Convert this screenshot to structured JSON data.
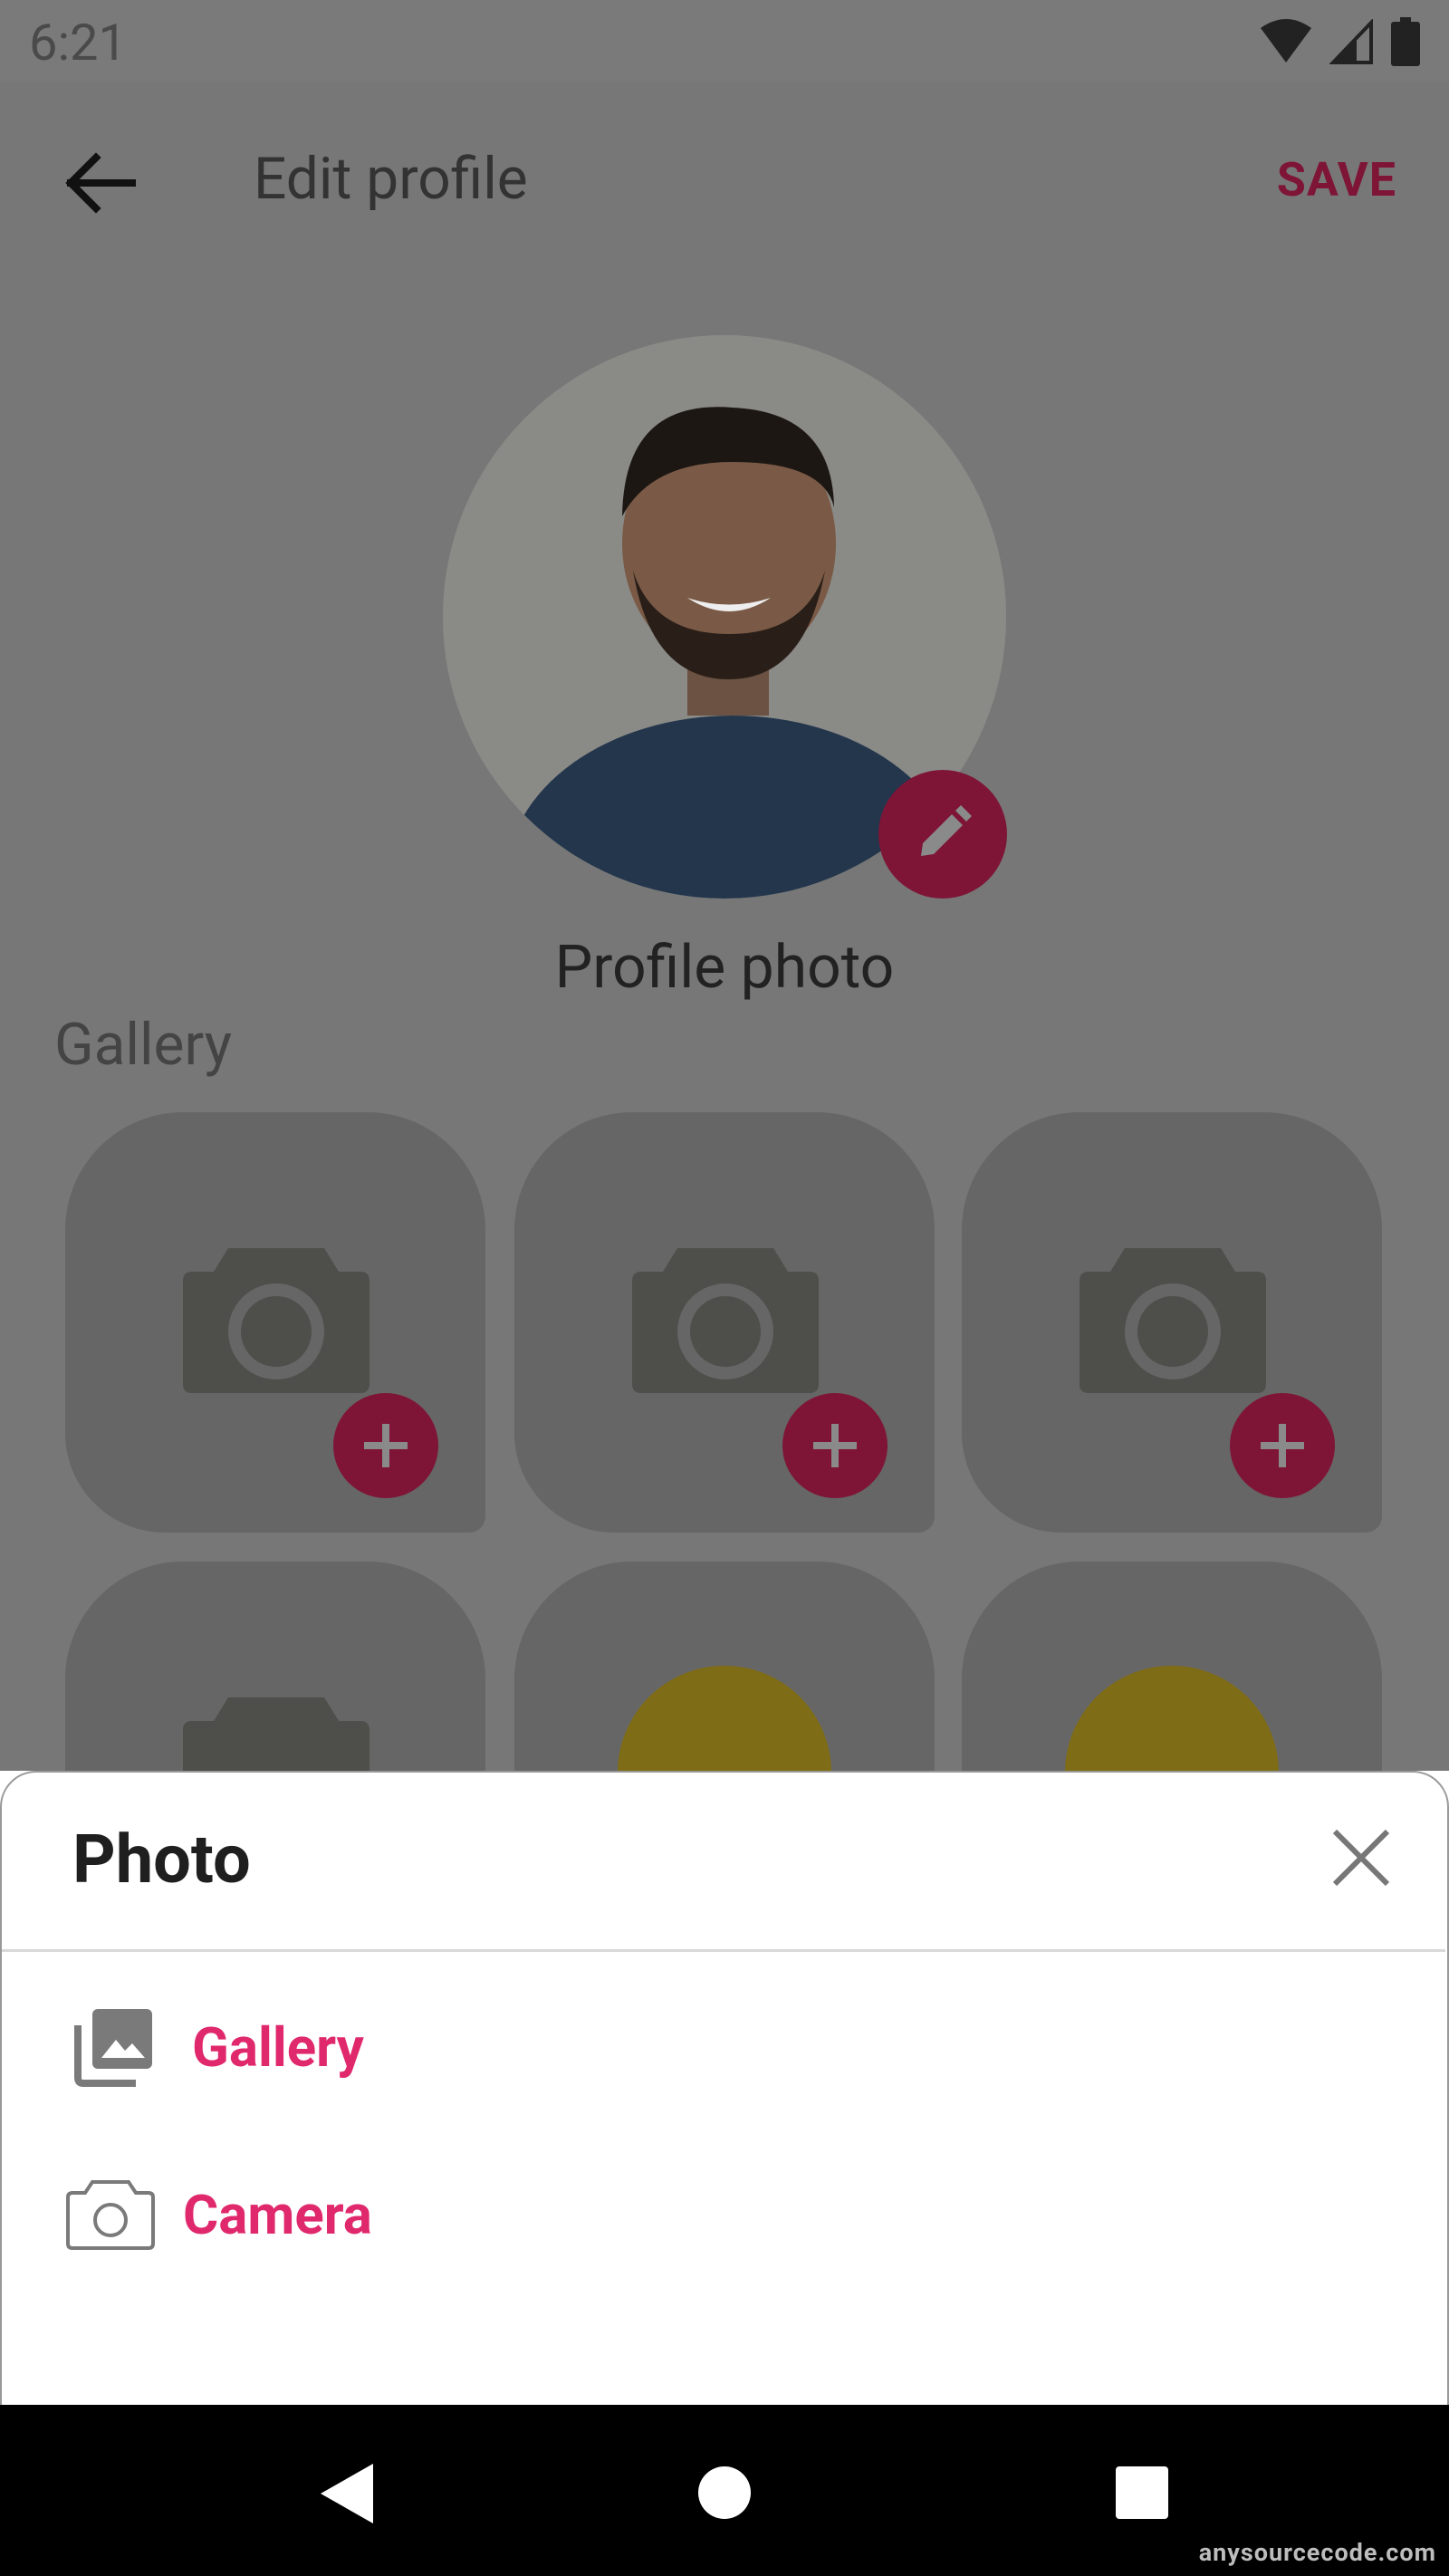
{
  "status_bar": {
    "time": "6:21"
  },
  "app_bar": {
    "title": "Edit profile",
    "save_label": "SAVE"
  },
  "profile": {
    "label": "Profile photo"
  },
  "gallery": {
    "label": "Gallery"
  },
  "sheet": {
    "title": "Photo",
    "options": [
      {
        "label": "Gallery",
        "icon": "photo-library-icon"
      },
      {
        "label": "Camera",
        "icon": "camera-icon"
      }
    ]
  },
  "watermark": "anysourcecode.com",
  "colors": {
    "accent": "#e0296d",
    "accent_dimmed": "#7e1537",
    "scrim": "#777777"
  }
}
